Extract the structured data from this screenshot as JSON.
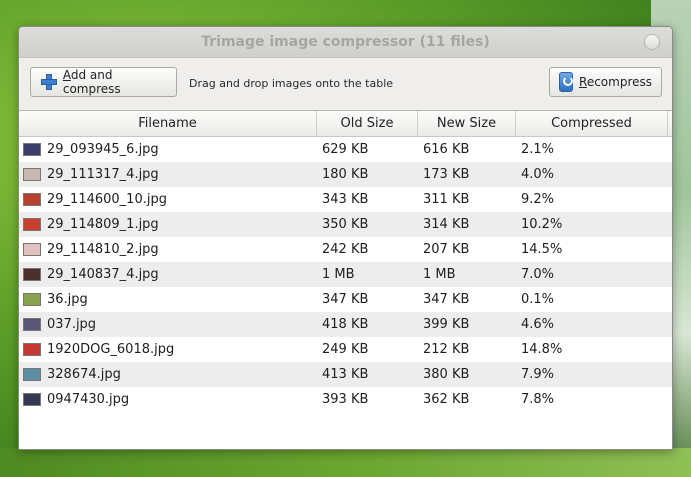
{
  "window": {
    "title": "Trimage image compressor (11 files)"
  },
  "toolbar": {
    "add_label_first": "A",
    "add_label_rest": "dd and compress",
    "hint": "Drag and drop images onto the table",
    "recompress_label_first": "R",
    "recompress_label_rest": "ecompress"
  },
  "table": {
    "columns": [
      "Filename",
      "Old Size",
      "New Size",
      "Compressed"
    ],
    "rows": [
      {
        "filename": "29_093945_6.jpg",
        "old": "629 KB",
        "new": "616 KB",
        "pct": "2.1%",
        "thumb_color": "#3a3f6a"
      },
      {
        "filename": "29_111317_4.jpg",
        "old": "180 KB",
        "new": "173 KB",
        "pct": "4.0%",
        "thumb_color": "#c9b7b2"
      },
      {
        "filename": "29_114600_10.jpg",
        "old": "343 KB",
        "new": "311 KB",
        "pct": "9.2%",
        "thumb_color": "#b5412e"
      },
      {
        "filename": "29_114809_1.jpg",
        "old": "350 KB",
        "new": "314 KB",
        "pct": "10.2%",
        "thumb_color": "#c7402f"
      },
      {
        "filename": "29_114810_2.jpg",
        "old": "242 KB",
        "new": "207 KB",
        "pct": "14.5%",
        "thumb_color": "#e0c2c0"
      },
      {
        "filename": "29_140837_4.jpg",
        "old": "1 MB",
        "new": "1 MB",
        "pct": "7.0%",
        "thumb_color": "#4a2f2a"
      },
      {
        "filename": "36.jpg",
        "old": "347 KB",
        "new": "347 KB",
        "pct": "0.1%",
        "thumb_color": "#8aa24f"
      },
      {
        "filename": "037.jpg",
        "old": "418 KB",
        "new": "399 KB",
        "pct": "4.6%",
        "thumb_color": "#5a5475"
      },
      {
        "filename": "1920DOG_6018.jpg",
        "old": "249 KB",
        "new": "212 KB",
        "pct": "14.8%",
        "thumb_color": "#c23a33"
      },
      {
        "filename": "328674.jpg",
        "old": "413 KB",
        "new": "380 KB",
        "pct": "7.9%",
        "thumb_color": "#5d8fa3"
      },
      {
        "filename": "0947430.jpg",
        "old": "393 KB",
        "new": "362 KB",
        "pct": "7.8%",
        "thumb_color": "#343a52"
      }
    ]
  }
}
